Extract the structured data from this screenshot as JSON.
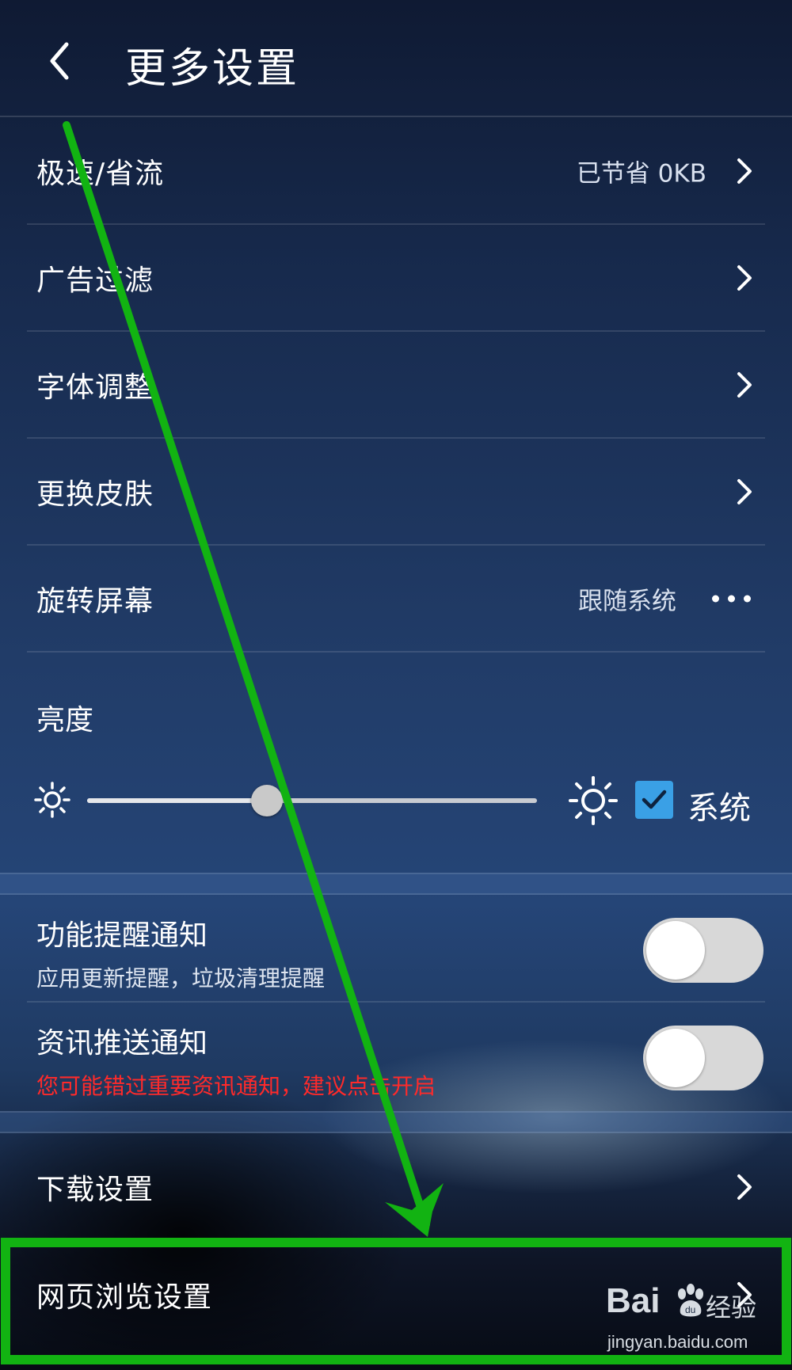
{
  "header": {
    "title": "更多设置"
  },
  "menu": [
    {
      "label": "极速/省流",
      "value": "已节省 0KB"
    },
    {
      "label": "广告过滤",
      "value": ""
    },
    {
      "label": "字体调整",
      "value": ""
    },
    {
      "label": "更换皮肤",
      "value": ""
    },
    {
      "label": "旋转屏幕",
      "value": "跟随系统"
    }
  ],
  "brightness": {
    "label": "亮度",
    "level_fraction": 0.4,
    "system_label": "系统",
    "system_checked": true
  },
  "notifications": [
    {
      "label": "功能提醒通知",
      "subtitle": "应用更新提醒，垃圾清理提醒",
      "enabled": false
    },
    {
      "label": "资讯推送通知",
      "subtitle": "您可能错过重要资讯通知，建议点击开启",
      "enabled": false
    }
  ],
  "settings": [
    {
      "label": "下载设置"
    },
    {
      "label": "网页浏览设置"
    }
  ],
  "watermark": {
    "brand": "Bai",
    "brand_cn": "经验",
    "url": "jingyan.baidu.com"
  },
  "colors": {
    "annotation_green": "#12b312",
    "warning_red": "#ff2a2a",
    "checkbox_blue": "#3aa0e6"
  }
}
